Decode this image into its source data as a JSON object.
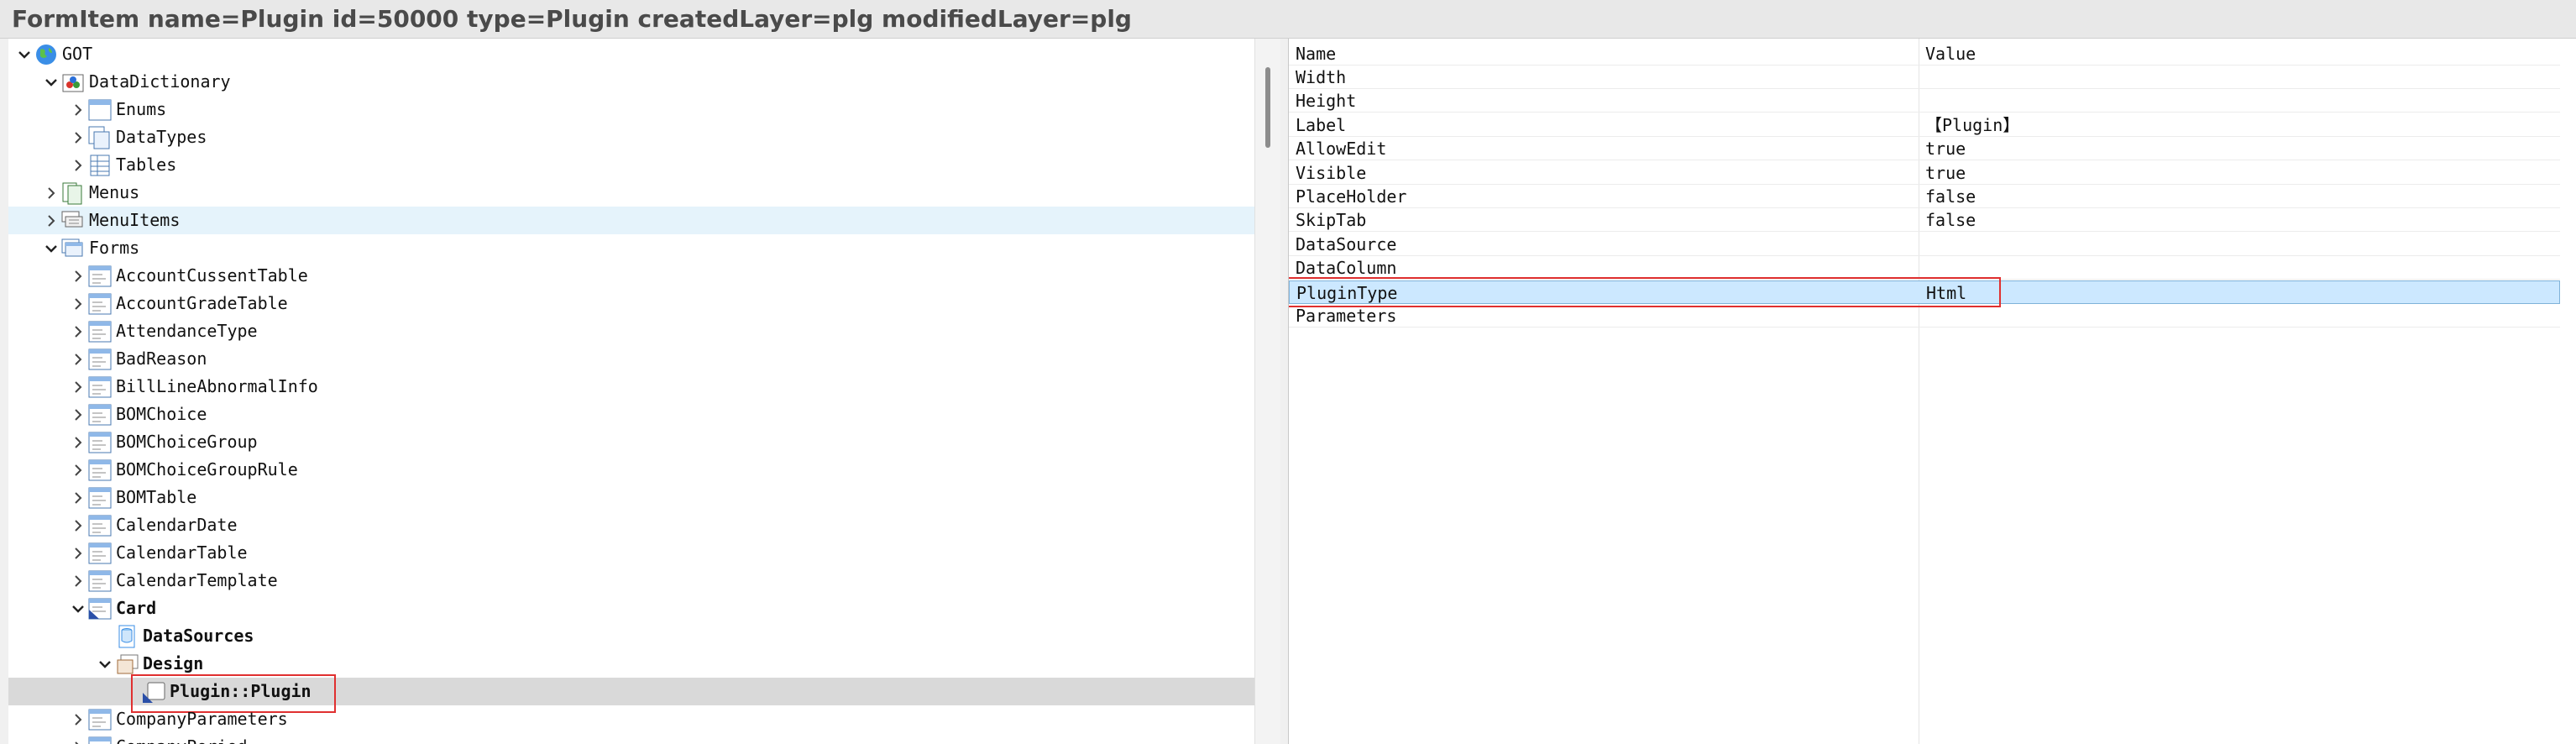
{
  "window": {
    "title": "FormItem name=Plugin id=50000 type=Plugin createdLayer=plg modifiedLayer=plg"
  },
  "tree": {
    "nodes": [
      {
        "label": "GOT",
        "depth": 0,
        "expanded": true,
        "icon": "globe-icon"
      },
      {
        "label": "DataDictionary",
        "depth": 1,
        "expanded": true,
        "icon": "data-dictionary-icon"
      },
      {
        "label": "Enums",
        "depth": 2,
        "expanded": false,
        "icon": "enum-icon"
      },
      {
        "label": "DataTypes",
        "depth": 2,
        "expanded": false,
        "icon": "datatypes-icon"
      },
      {
        "label": "Tables",
        "depth": 2,
        "expanded": false,
        "icon": "tables-icon"
      },
      {
        "label": "Menus",
        "depth": 1,
        "expanded": false,
        "icon": "menus-icon"
      },
      {
        "label": "MenuItems",
        "depth": 1,
        "expanded": false,
        "icon": "menuitems-icon"
      },
      {
        "label": "Forms",
        "depth": 1,
        "expanded": true,
        "icon": "forms-icon"
      },
      {
        "label": "AccountCussentTable",
        "depth": 2,
        "expanded": false,
        "icon": "form-icon"
      },
      {
        "label": "AccountGradeTable",
        "depth": 2,
        "expanded": false,
        "icon": "form-icon"
      },
      {
        "label": "AttendanceType",
        "depth": 2,
        "expanded": false,
        "icon": "form-icon"
      },
      {
        "label": "BadReason",
        "depth": 2,
        "expanded": false,
        "icon": "form-icon"
      },
      {
        "label": "BillLineAbnormalInfo",
        "depth": 2,
        "expanded": false,
        "icon": "form-icon"
      },
      {
        "label": "BOMChoice",
        "depth": 2,
        "expanded": false,
        "icon": "form-icon"
      },
      {
        "label": "BOMChoiceGroup",
        "depth": 2,
        "expanded": false,
        "icon": "form-icon"
      },
      {
        "label": "BOMChoiceGroupRule",
        "depth": 2,
        "expanded": false,
        "icon": "form-icon"
      },
      {
        "label": "BOMTable",
        "depth": 2,
        "expanded": false,
        "icon": "form-icon"
      },
      {
        "label": "CalendarDate",
        "depth": 2,
        "expanded": false,
        "icon": "form-icon"
      },
      {
        "label": "CalendarTable",
        "depth": 2,
        "expanded": false,
        "icon": "form-icon"
      },
      {
        "label": "CalendarTemplate",
        "depth": 2,
        "expanded": false,
        "icon": "form-icon"
      },
      {
        "label": "Card",
        "depth": 2,
        "expanded": true,
        "icon": "form-modified-icon",
        "bold": true
      },
      {
        "label": "DataSources",
        "depth": 3,
        "expanded": null,
        "icon": "datasources-icon",
        "bold": true
      },
      {
        "label": "Design",
        "depth": 3,
        "expanded": true,
        "icon": "design-icon",
        "bold": true
      },
      {
        "label": "Plugin::Plugin",
        "depth": 4,
        "expanded": null,
        "icon": "plugin-icon",
        "bold": true,
        "selected": true
      },
      {
        "label": "CompanyParameters",
        "depth": 2,
        "expanded": false,
        "icon": "form-icon"
      },
      {
        "label": "CompanyPeriod",
        "depth": 2,
        "expanded": false,
        "icon": "form-icon"
      }
    ]
  },
  "properties": {
    "header": {
      "name": "Name",
      "value": "Value"
    },
    "rows": [
      {
        "name": "Width",
        "value": ""
      },
      {
        "name": "Height",
        "value": ""
      },
      {
        "name": "Label",
        "value": "【Plugin】"
      },
      {
        "name": "AllowEdit",
        "value": "true"
      },
      {
        "name": "Visible",
        "value": "true"
      },
      {
        "name": "PlaceHolder",
        "value": "false"
      },
      {
        "name": "SkipTab",
        "value": "false"
      },
      {
        "name": "DataSource",
        "value": ""
      },
      {
        "name": "DataColumn",
        "value": ""
      },
      {
        "name": "PluginType",
        "value": "Html",
        "selected": true
      },
      {
        "name": "Parameters",
        "value": ""
      }
    ]
  },
  "colors": {
    "highlight": "#e03030",
    "selection": "#cce8ff",
    "tree_hover": "#e5f3fb",
    "tree_selected": "#d9d9d9"
  }
}
